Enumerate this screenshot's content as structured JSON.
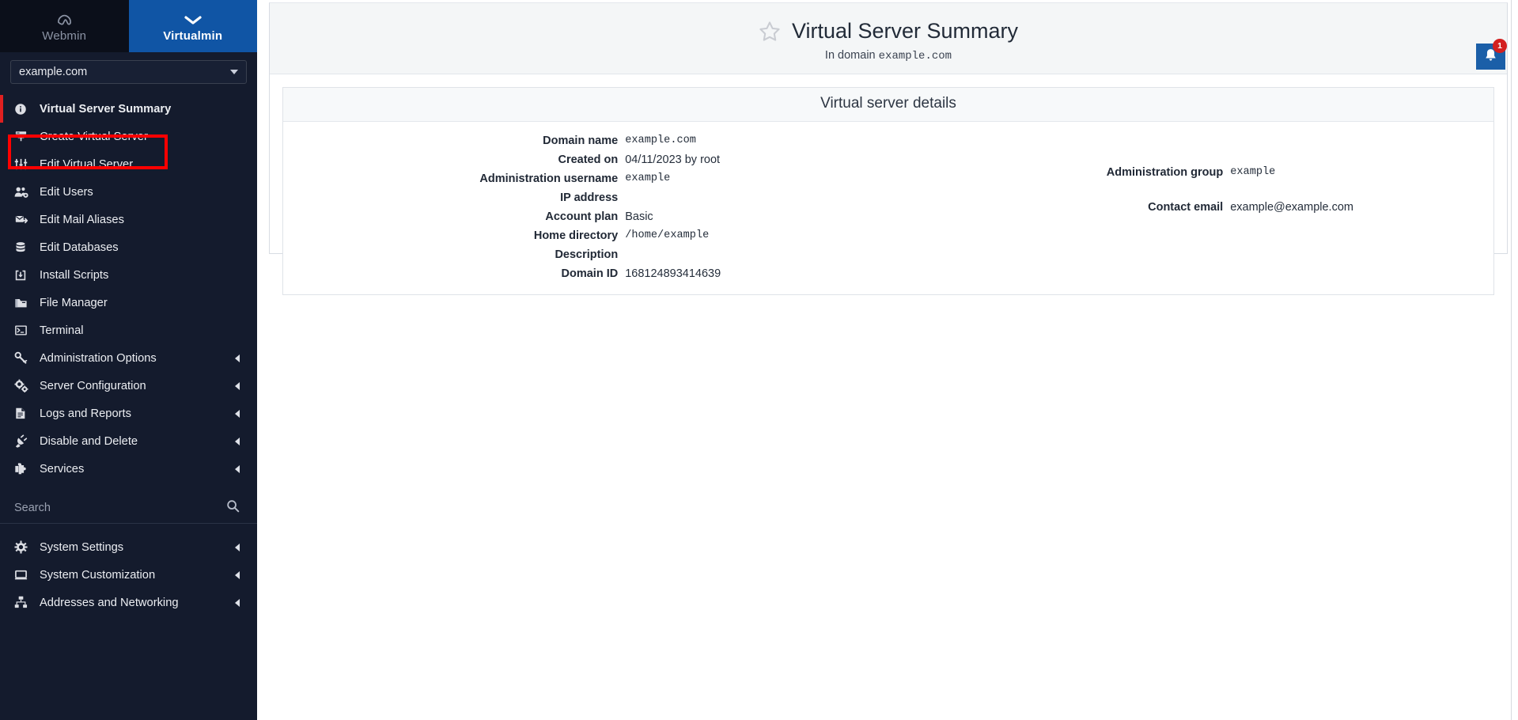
{
  "brand": {
    "webmin": {
      "label": "Webmin",
      "icon": "webmin-logo-icon"
    },
    "virtualmin": {
      "label": "Virtualmin",
      "icon": "chevron-down-icon"
    }
  },
  "sidebar": {
    "domain_selector": {
      "value": "example.com",
      "icon": "chevron-down-icon"
    },
    "search": {
      "placeholder": "Search",
      "value": "",
      "icon": "search-icon"
    },
    "primary_items": [
      {
        "label": "Virtual Server Summary",
        "icon": "info-circle-icon",
        "active": true,
        "expandable": false
      },
      {
        "label": "Create Virtual Server",
        "icon": "server-add-icon",
        "active": false,
        "expandable": false,
        "highlighted": true
      },
      {
        "label": "Edit Virtual Server",
        "icon": "sliders-icon",
        "active": false,
        "expandable": false
      },
      {
        "label": "Edit Users",
        "icon": "users-gear-icon",
        "active": false,
        "expandable": false
      },
      {
        "label": "Edit Mail Aliases",
        "icon": "mail-forward-icon",
        "active": false,
        "expandable": false
      },
      {
        "label": "Edit Databases",
        "icon": "database-icon",
        "active": false,
        "expandable": false
      },
      {
        "label": "Install Scripts",
        "icon": "download-box-icon",
        "active": false,
        "expandable": false
      },
      {
        "label": "File Manager",
        "icon": "folder-icon",
        "active": false,
        "expandable": false
      },
      {
        "label": "Terminal",
        "icon": "terminal-icon",
        "active": false,
        "expandable": false
      },
      {
        "label": "Administration Options",
        "icon": "wrench-icon",
        "active": false,
        "expandable": true
      },
      {
        "label": "Server Configuration",
        "icon": "gears-icon",
        "active": false,
        "expandable": true
      },
      {
        "label": "Logs and Reports",
        "icon": "document-lines-icon",
        "active": false,
        "expandable": true
      },
      {
        "label": "Disable and Delete",
        "icon": "plug-icon",
        "active": false,
        "expandable": true
      },
      {
        "label": "Services",
        "icon": "puzzle-piece-icon",
        "active": false,
        "expandable": true
      }
    ],
    "secondary_items": [
      {
        "label": "System Settings",
        "icon": "gear-icon",
        "expandable": true
      },
      {
        "label": "System Customization",
        "icon": "monitor-icon",
        "expandable": true
      },
      {
        "label": "Addresses and Networking",
        "icon": "network-icon",
        "expandable": true
      }
    ]
  },
  "header": {
    "title": "Virtual Server Summary",
    "subtitle_prefix": "In domain ",
    "subtitle_domain": "example.com",
    "favorite_icon": "star-outline-icon"
  },
  "details": {
    "title": "Virtual server details",
    "left": [
      {
        "label": "Domain name",
        "value": "example.com",
        "mono": true
      },
      {
        "label": "Created on",
        "value": "04/11/2023 by root",
        "mono": false
      },
      {
        "label": "Administration username",
        "value": "example",
        "mono": true
      },
      {
        "label": "IP address",
        "value": "",
        "mono": true
      },
      {
        "label": "Account plan",
        "value": "Basic",
        "mono": false
      },
      {
        "label": "Home directory",
        "value": "/home/example",
        "mono": true
      },
      {
        "label": "Description",
        "value": "",
        "mono": false
      },
      {
        "label": "Domain ID",
        "value": "168124893414639",
        "mono": false
      }
    ],
    "right": [
      {
        "label": "",
        "value": "",
        "mono": false
      },
      {
        "label": "",
        "value": "",
        "mono": false
      },
      {
        "label": "Administration group",
        "value": "example",
        "mono": true
      },
      {
        "label": "",
        "value": "",
        "mono": false
      },
      {
        "label": "Contact email",
        "value": "example@example.com",
        "mono": false
      },
      {
        "label": "",
        "value": "",
        "mono": false
      },
      {
        "label": "",
        "value": "",
        "mono": false
      },
      {
        "label": "",
        "value": "",
        "mono": false
      }
    ]
  },
  "notifications": {
    "count": "1",
    "icon": "bell-icon"
  },
  "colors": {
    "sidebar_bg": "#141b2d",
    "brand_active": "#1055a5",
    "highlight_red": "#ff0000",
    "accent_red": "#e02020",
    "badge_red": "#d32020",
    "notif_blue": "#1b5fa8"
  }
}
